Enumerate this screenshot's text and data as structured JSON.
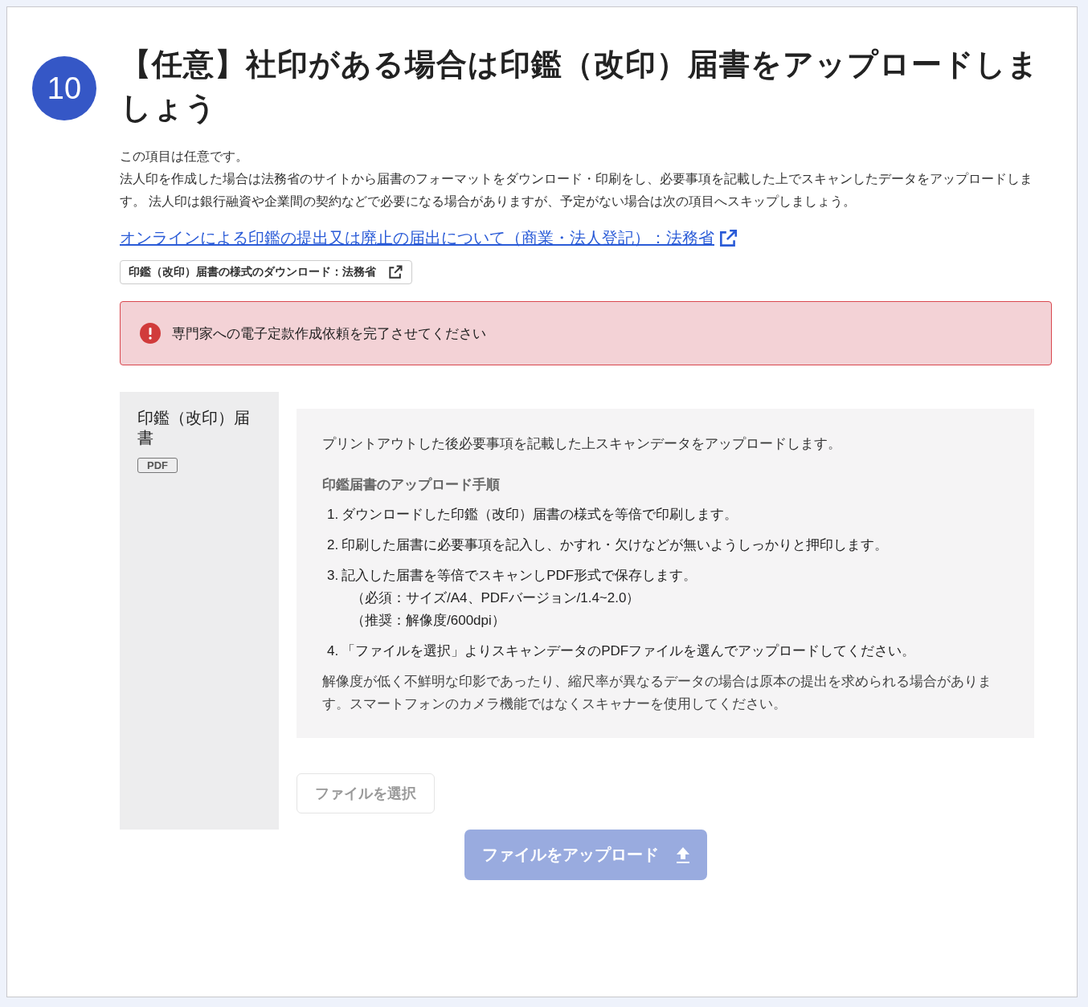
{
  "step": {
    "number": "10",
    "title": "【任意】社印がある場合は印鑑（改印）届書をアップロードしましょう"
  },
  "description": [
    "この項目は任意です。",
    "法人印を作成した場合は法務省のサイトから届書のフォーマットをダウンロード・印刷をし、必要事項を記載した上でスキャンしたデータをアップロードします。 法人印は銀行融資や企業間の契約などで必要になる場合がありますが、予定がない場合は次の項目へスキップしましょう。"
  ],
  "link": {
    "text": "オンラインによる印鑑の提出又は廃止の届出について（商業・法人登記）：法務省"
  },
  "download_button": {
    "label": "印鑑（改印）届書の様式のダウンロード：法務省"
  },
  "alert": {
    "kind": "error",
    "message": "専門家への電子定款作成依頼を完了させてください"
  },
  "document": {
    "name": "印鑑（改印）届書",
    "format": "PDF",
    "intro": "プリントアウトした後必要事項を記載した上スキャンデータをアップロードします。",
    "steps_heading": "印鑑届書のアップロード手順",
    "steps": [
      {
        "number": "1.",
        "text": "ダウンロードした印鑑（改印）届書の様式を等倍で印刷します。"
      },
      {
        "number": "2.",
        "text": "印刷した届書に必要事項を記入し、かすれ・欠けなどが無いようしっかりと押印します。"
      },
      {
        "number": "3.",
        "text": "記入した届書を等倍でスキャンしPDF形式で保存します。",
        "notes": [
          "（必須：サイズ/A4、PDFバージョン/1.4~2.0）",
          "（推奨：解像度/600dpi）"
        ]
      },
      {
        "number": "4.",
        "text": "「ファイルを選択」よりスキャンデータのPDFファイルを選んでアップロードしてください。"
      }
    ],
    "note": "解像度が低く不鮮明な印影であったり、縮尺率が異なるデータの場合は原本の提出を求められる場合があります。スマートフォンのカメラ機能ではなくスキャナーを使用してください。"
  },
  "select_button": {
    "label": "ファイルを選択",
    "disabled": true
  },
  "upload_button": {
    "label": "ファイルをアップロード",
    "disabled": true
  }
}
